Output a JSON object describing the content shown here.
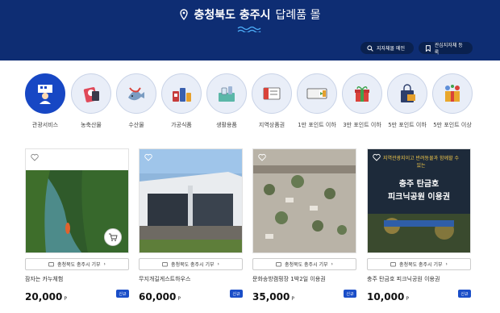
{
  "header": {
    "title_strong": "충청북도 충주시",
    "title_light": "답례품 몰",
    "btn_region": "지자체몰 메인",
    "btn_favorite": "관심지자체 등록"
  },
  "categories": [
    {
      "label": "관광서비스",
      "icon": "tourism-icon",
      "active": true
    },
    {
      "label": "농축산물",
      "icon": "agriculture-icon"
    },
    {
      "label": "수산물",
      "icon": "seafood-icon"
    },
    {
      "label": "가공식품",
      "icon": "processed-food-icon"
    },
    {
      "label": "생활용품",
      "icon": "household-icon"
    },
    {
      "label": "지역상품권",
      "icon": "voucher-icon"
    },
    {
      "label": "1만 포인트 이하",
      "icon": "point-ticket-icon"
    },
    {
      "label": "3만 포인트 이하",
      "icon": "gift-box-icon"
    },
    {
      "label": "5만 포인트 이하",
      "icon": "shopping-bag-icon"
    },
    {
      "label": "5만 포인트 이상",
      "icon": "premium-gift-icon"
    }
  ],
  "products": [
    {
      "donate": "충청북도 충주시 기부",
      "name": "잠자는 카누체험",
      "price": "20,000",
      "won": "P",
      "badge": "신규"
    },
    {
      "donate": "충청북도 충주시 기부",
      "name": "무지개길게스트하우스",
      "price": "60,000",
      "won": "P",
      "badge": "신규"
    },
    {
      "donate": "충청북도 충주시 기부",
      "name": "문화송방캠핑장 1박2일 이용권",
      "price": "35,000",
      "won": "P",
      "badge": "신규"
    },
    {
      "donate": "충청북도 충주시 기부",
      "name": "충주 탄금호 피크닉공원 이용권",
      "price": "10,000",
      "won": "P",
      "badge": "신규",
      "image_text_small": "지역관광지이고 반려동물과 함께할 수 있는",
      "image_text_big1": "충주 탄금호",
      "image_text_big2": "피크닉공원 이용권"
    }
  ],
  "colors": {
    "header": "#0e2d73",
    "accent": "#1747c4",
    "badge": "#1a4ec8"
  }
}
